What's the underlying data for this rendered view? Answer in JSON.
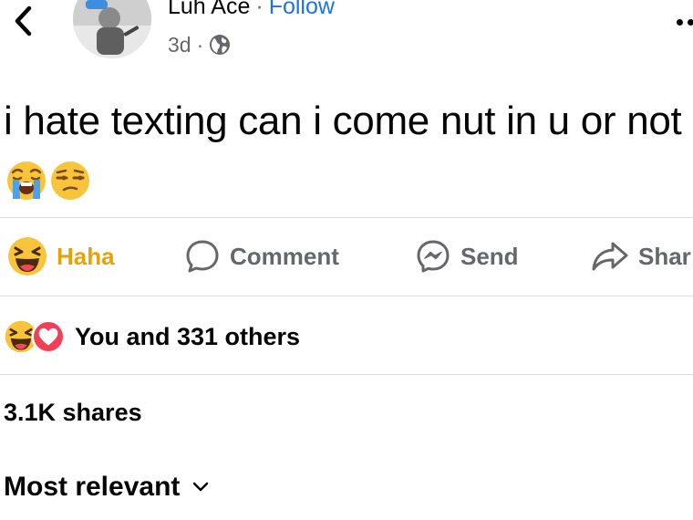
{
  "header": {
    "author_name": "Luh Ace",
    "separator": "·",
    "follow_label": "Follow",
    "time_ago": "3d",
    "meta_separator": "·",
    "privacy_icon": "globe-icon",
    "back_icon": "chevron-left-icon",
    "more_icon": "more-dots-icon"
  },
  "post": {
    "text": "i hate texting can i come nut in u or not",
    "emojis": [
      "loudly-crying-face-icon",
      "unamused-face-icon"
    ]
  },
  "actions": [
    {
      "label": "Haha",
      "icon": "haha-reaction-icon",
      "active": true
    },
    {
      "label": "Comment",
      "icon": "comment-bubble-icon"
    },
    {
      "label": "Send",
      "icon": "messenger-icon"
    },
    {
      "label": "Shar",
      "icon": "share-arrow-icon"
    }
  ],
  "reactions": {
    "summary": "You and 331 others",
    "icons": [
      "haha-reaction-icon",
      "love-reaction-icon"
    ]
  },
  "shares": "3.1K shares",
  "comments_sort": {
    "label": "Most relevant",
    "icon": "chevron-down-icon"
  },
  "colors": {
    "text": "#050505",
    "secondary": "#65676b",
    "link": "#1b74e4",
    "haha": "#e6a20a",
    "love": "#f33e58",
    "divider": "#dadde1"
  }
}
